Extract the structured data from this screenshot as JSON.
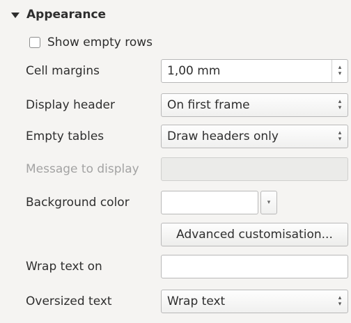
{
  "section": {
    "title": "Appearance",
    "expanded": true
  },
  "show_empty_rows": {
    "label": "Show empty rows",
    "checked": false
  },
  "rows": {
    "cell_margins": {
      "label": "Cell margins",
      "value": "1,00 mm"
    },
    "display_header": {
      "label": "Display header",
      "value": "On first frame"
    },
    "empty_tables": {
      "label": "Empty tables",
      "value": "Draw headers only"
    },
    "message_to_display": {
      "label": "Message to display",
      "value": ""
    },
    "background_color": {
      "label": "Background color",
      "color": "#ffffff"
    },
    "advanced_button": {
      "label": "Advanced customisation..."
    },
    "wrap_text_on": {
      "label": "Wrap text on",
      "value": ""
    },
    "oversized_text": {
      "label": "Oversized text",
      "value": "Wrap text"
    }
  },
  "icons": {
    "expand": "triangle-down-icon",
    "spin": "spin-arrows-icon",
    "combo": "combo-arrows-icon",
    "color_drop": "dropdown-arrow-icon"
  }
}
